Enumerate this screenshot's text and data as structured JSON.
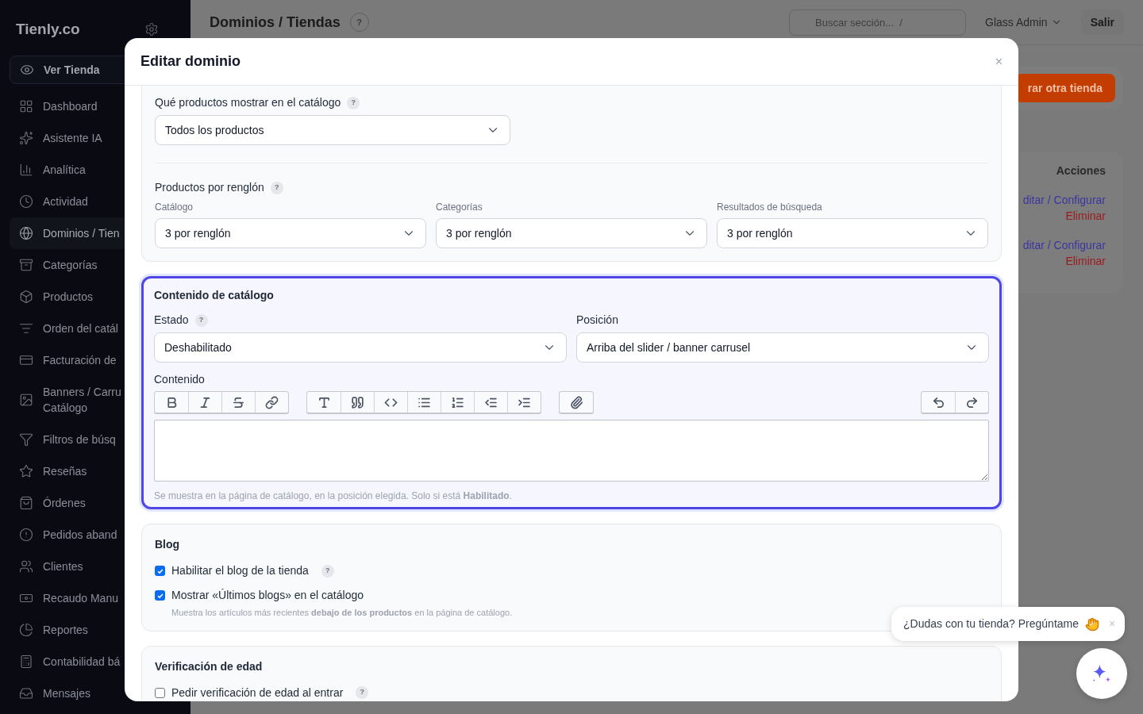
{
  "sidebar": {
    "brand": "Tienly.co",
    "view_store": "Ver Tienda",
    "items": [
      {
        "label": "Dashboard",
        "selected": false
      },
      {
        "label": "Asistente IA",
        "selected": false
      },
      {
        "label": "Analítica",
        "selected": false
      },
      {
        "label": "Actividad",
        "selected": false
      },
      {
        "label": "Dominios / Tien",
        "selected": true
      },
      {
        "label": "Categorías",
        "selected": false
      },
      {
        "label": "Productos",
        "selected": false
      },
      {
        "label": "Orden del catál",
        "selected": false
      },
      {
        "label": "Facturación de",
        "selected": false
      },
      {
        "label": "Banners / Carru",
        "label_line2": "Catálogo",
        "selected": false
      },
      {
        "label": "Filtros de búsq",
        "selected": false
      },
      {
        "label": "Reseñas",
        "selected": false
      },
      {
        "label": "Órdenes",
        "selected": false
      },
      {
        "label": "Pedidos aband",
        "selected": false
      },
      {
        "label": "Clientes",
        "selected": false
      },
      {
        "label": "Recaudo Manu",
        "selected": false
      },
      {
        "label": "Reportes",
        "selected": false
      },
      {
        "label": "Contabilidad bá",
        "selected": false
      },
      {
        "label": "Mensajes",
        "selected": false
      }
    ]
  },
  "header": {
    "title": "Dominios / Tiendas",
    "help": "?",
    "search_placeholder": "Buscar sección...  /",
    "user": "Glass Admin",
    "logout": "Salir"
  },
  "background": {
    "action_button": "rar otra tienda",
    "table_header": "Acciones",
    "rows": [
      {
        "edit": "ditar / Configurar",
        "delete": "Eliminar"
      },
      {
        "edit": "ditar / Configurar",
        "delete": "Eliminar"
      }
    ]
  },
  "modal": {
    "title": "Editar dominio",
    "close": "×",
    "catalog": {
      "products_label": "Qué productos mostrar en el catálogo",
      "products_help": "?",
      "products_value": "Todos los productos",
      "per_row_label": "Productos por renglón",
      "per_row_help": "?",
      "per_row": [
        {
          "label": "Catálogo",
          "value": "3 por renglón"
        },
        {
          "label": "Categorías",
          "value": "3 por renglón"
        },
        {
          "label": "Resultados de búsqueda",
          "value": "3 por renglón"
        }
      ]
    },
    "content": {
      "title": "Contenido de catálogo",
      "focused": true,
      "state_label": "Estado",
      "state_help": "?",
      "state_value": "Deshabilitado",
      "position_label": "Posición",
      "position_value": "Arriba del slider / banner carrusel",
      "editor_label": "Contenido",
      "hint": "Se muestra en la página de catálogo, en la posición elegida. Solo si está **Habilitado**."
    },
    "blog": {
      "title": "Blog",
      "options": [
        {
          "label": "Habilitar el blog de la tienda",
          "checked": true,
          "help": "?"
        },
        {
          "label": "Mostrar «Últimos blogs» en el catálogo",
          "checked": true,
          "hint": "Muestra los artículos más recientes **debajo de los productos** en la página de catálogo."
        }
      ]
    },
    "age": {
      "title": "Verificación de edad",
      "options": [
        {
          "label": "Pedir verificación de edad al entrar",
          "checked": false,
          "help": "?"
        }
      ]
    }
  },
  "chat": {
    "bubble": "¿Dudas con tu tienda? Pregúntame",
    "close": "×"
  }
}
